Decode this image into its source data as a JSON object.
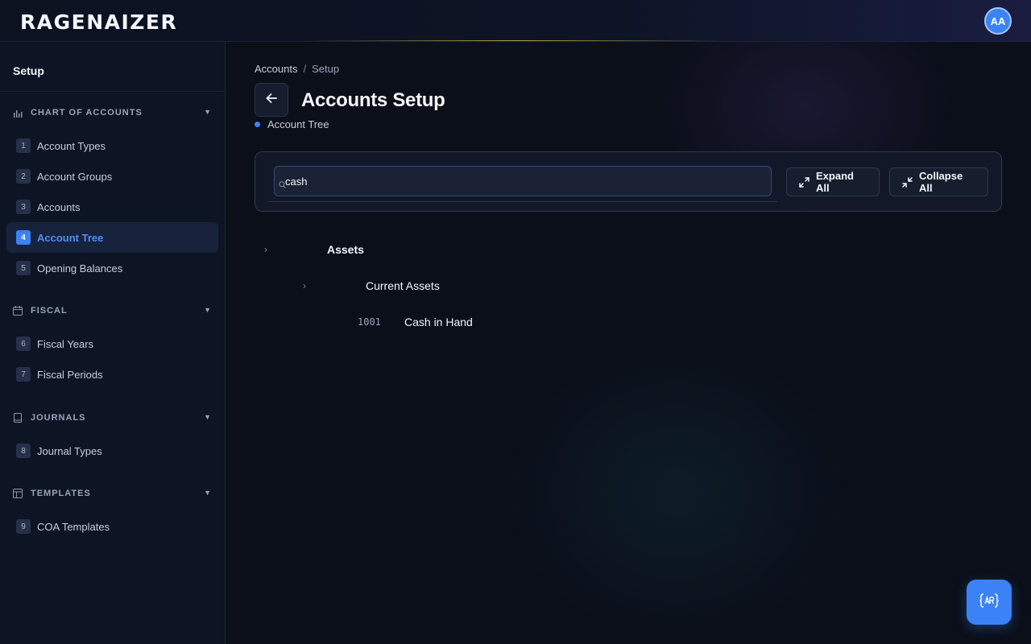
{
  "app": {
    "logo_text": "RAGENAIZER",
    "avatar_initials": "AA"
  },
  "sidebar": {
    "title": "Setup",
    "sections": [
      {
        "label": "CHART OF ACCOUNTS",
        "icon": "bar-chart-icon",
        "items": [
          {
            "num": "1",
            "label": "Account Types"
          },
          {
            "num": "2",
            "label": "Account Groups"
          },
          {
            "num": "3",
            "label": "Accounts"
          },
          {
            "num": "4",
            "label": "Account Tree",
            "active": true
          },
          {
            "num": "5",
            "label": "Opening Balances"
          }
        ]
      },
      {
        "label": "FISCAL",
        "icon": "calendar-icon",
        "items": [
          {
            "num": "6",
            "label": "Fiscal Years"
          },
          {
            "num": "7",
            "label": "Fiscal Periods"
          }
        ]
      },
      {
        "label": "JOURNALS",
        "icon": "book-icon",
        "items": [
          {
            "num": "8",
            "label": "Journal Types"
          }
        ]
      },
      {
        "label": "TEMPLATES",
        "icon": "layout-icon",
        "items": [
          {
            "num": "9",
            "label": "COA Templates"
          }
        ]
      }
    ]
  },
  "breadcrumb": {
    "root": "Accounts",
    "separator": "/",
    "current": "Setup"
  },
  "page": {
    "title": "Accounts Setup",
    "subtitle": "Account Tree"
  },
  "toolbar": {
    "search_value": "cash",
    "expand_label": "Expand All",
    "collapse_label": "Collapse All"
  },
  "tree": [
    {
      "level": 0,
      "label": "Assets",
      "has_children": true
    },
    {
      "level": 1,
      "label": "Current Assets",
      "has_children": true
    },
    {
      "level": 2,
      "code": "1001",
      "label": "Cash in Hand",
      "has_children": false
    }
  ],
  "colors": {
    "accent": "#3b82f6",
    "background": "#0b0f1a",
    "sidebar": "#0d1424"
  }
}
